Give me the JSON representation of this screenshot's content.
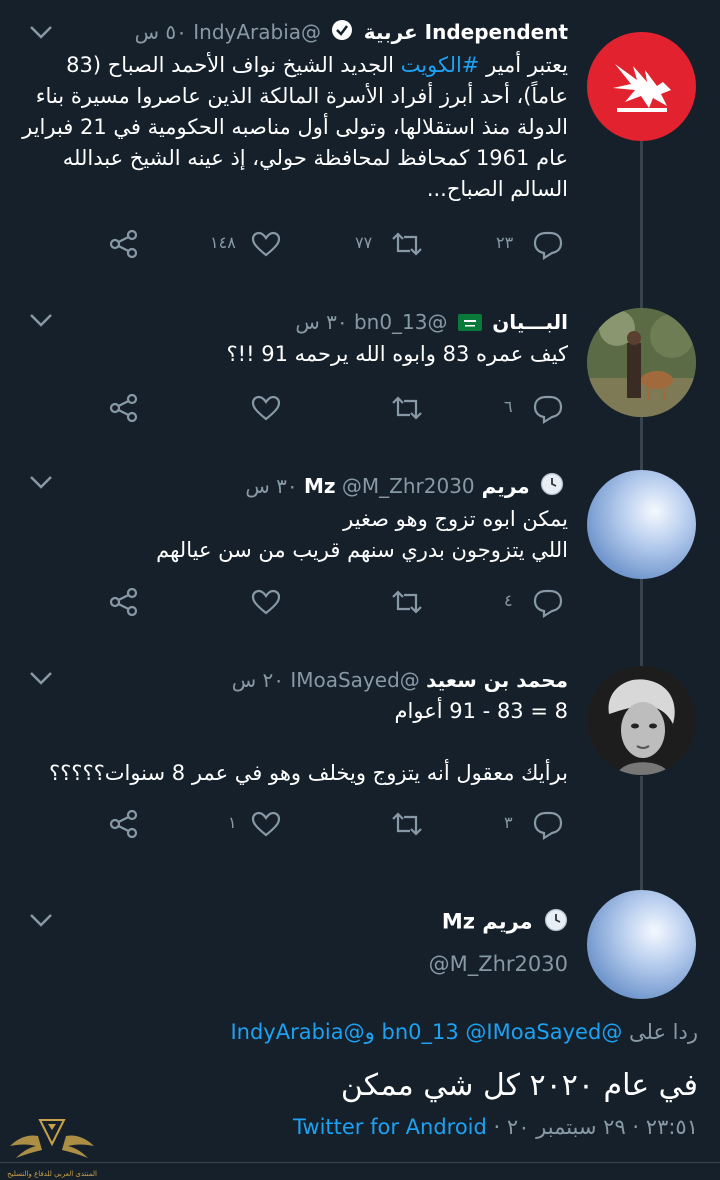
{
  "tweets": [
    {
      "name": "Independent عربية",
      "handle": "@IndyArabia",
      "time": "٥٠ س",
      "text_before": "يعتبر أمير ",
      "hashtag": "#الكويت",
      "text_line1_rest": " الجديد الشيخ نواف الأحمد الصباح (83",
      "text_lines": [
        "عاماً)، أحد أبرز أفراد الأسرة المالكة الذين عاصروا مسيرة بناء",
        "الدولة منذ استقلالها، وتولى أول مناصبه الحكومية في 21 فبراير",
        "عام 1961 كمحافظ لمحافظة حولي، إذ عينه الشيخ عبدالله",
        "السالم الصباح..."
      ],
      "replies": "٢٣",
      "retweets": "٧٧",
      "likes": "١٤٨",
      "avatar_icon": "eagle-logo-icon",
      "avatar_color": "#e2222e"
    },
    {
      "name": "البـــيان",
      "handle": "@bn0_13",
      "time": "٣٠ س",
      "badge": "saudi-flag-icon",
      "text_lines": [
        "كيف عمره 83 وابوه الله يرحمه 91 !!؟"
      ],
      "replies": "٦",
      "retweets": "",
      "likes": ""
    },
    {
      "name": "مريم Mz",
      "handle": "@M_Zhr2030",
      "time": "٣٠ س",
      "badge": "clock-icon",
      "text_lines": [
        "يمكن ابوه تزوج وهو صغير",
        "اللي يتزوجون بدري سنهم قريب من سن عيالهم"
      ],
      "replies": "٤",
      "retweets": "",
      "likes": ""
    },
    {
      "name": "محمد بن سعيد",
      "handle": "@IMoaSayed",
      "time": "٢٠ س",
      "text_lines": [
        "8 = 83 - 91 أعوام",
        "",
        "برأيك معقول أنه يتزوج ويخلف وهو في عمر 8 سنوات؟؟؟؟؟"
      ],
      "replies": "٣",
      "retweets": "",
      "likes": "١"
    }
  ],
  "main_tweet": {
    "name": "مريم Mz",
    "handle": "@M_Zhr2030",
    "replying_label": "ردا على",
    "mention_1": "@bn0_13",
    "mention_2": "@IMoaSayed",
    "and_word": "و",
    "mention_3": "@IndyArabia",
    "text": "في عام ٢٠٢٠ كل شي ممكن",
    "time": "٢٣:٥١",
    "date": "٢٩ سبتمبر ٢٠",
    "dot": "·",
    "source": "Twitter for Android"
  },
  "watermark": {
    "text": "المنتدى العربي للدفاع والتسليح"
  },
  "colors": {
    "background": "#15202b",
    "accent": "#1da1f2",
    "muted": "#8899a6",
    "divider": "#38444d"
  }
}
